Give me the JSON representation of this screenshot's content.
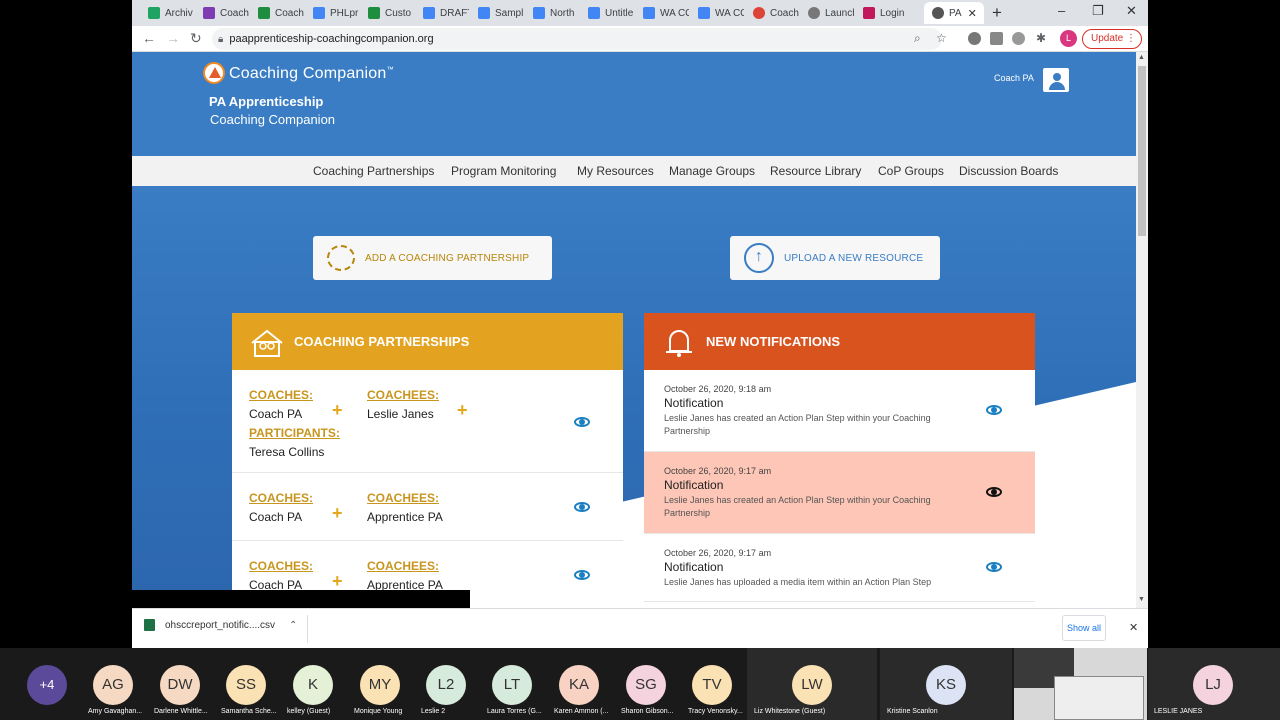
{
  "browser": {
    "tabs": [
      {
        "label": "Archiv",
        "color": "#1ea362"
      },
      {
        "label": "Coach",
        "color": "#7e3bb2"
      },
      {
        "label": "Coach",
        "color": "#1e8e3e"
      },
      {
        "label": "PHLpr",
        "color": "#4285f4"
      },
      {
        "label": "Custo",
        "color": "#1e8e3e"
      },
      {
        "label": "DRAFT",
        "color": "#4285f4"
      },
      {
        "label": "Sampl",
        "color": "#4285f4"
      },
      {
        "label": "North",
        "color": "#4285f4"
      },
      {
        "label": "Untitle",
        "color": "#4285f4"
      },
      {
        "label": "WA CC",
        "color": "#4285f4"
      },
      {
        "label": "WA CC",
        "color": "#4285f4"
      },
      {
        "label": "Coach",
        "color": "#db4437"
      },
      {
        "label": "Launch",
        "color": "#777777"
      },
      {
        "label": "Login",
        "color": "#c2185b"
      },
      {
        "label": "PA",
        "color": "#555555"
      }
    ],
    "url": "paapprenticeship-coachingcompanion.org",
    "profile_initial": "L",
    "update_label": "Update"
  },
  "header": {
    "logo_text": "Coaching Companion",
    "logo_tm": "™",
    "title_line1": "PA Apprenticeship",
    "title_line2": "Coaching Companion",
    "user_name": "Coach PA"
  },
  "nav": {
    "items": [
      "Coaching Partnerships",
      "Program Monitoring",
      "My Resources",
      "Manage Groups",
      "Resource Library",
      "CoP Groups",
      "Discussion Boards"
    ]
  },
  "actions": {
    "add_partnership": "ADD A COACHING PARTNERSHIP",
    "upload_resource": "UPLOAD A NEW RESOURCE"
  },
  "partnerships": {
    "title": "COACHING PARTNERSHIPS",
    "color": "#e3a320",
    "rows": [
      {
        "coaches_label": "COACHES:",
        "coach": "Coach PA",
        "coachees_label": "COACHEES:",
        "coachee": "Leslie Janes",
        "participants_label": "PARTICIPANTS:",
        "participant": "Teresa Collins"
      },
      {
        "coaches_label": "COACHES:",
        "coach": "Coach PA",
        "coachees_label": "COACHEES:",
        "coachee": "Apprentice PA"
      },
      {
        "coaches_label": "COACHES:",
        "coach": "Coach PA",
        "coachees_label": "COACHEES:",
        "coachee": "Apprentice PA"
      }
    ]
  },
  "notifications": {
    "title": "NEW NOTIFICATIONS",
    "color": "#d9531e",
    "items": [
      {
        "date": "October 26, 2020, 9:18 am",
        "title": "Notification",
        "desc": "Leslie Janes has created an Action Plan Step within your Coaching Partnership"
      },
      {
        "date": "October 26, 2020, 9:17 am",
        "title": "Notification",
        "desc": "Leslie Janes has created an Action Plan Step within your Coaching Partnership"
      },
      {
        "date": "October 26, 2020, 9:17 am",
        "title": "Notification",
        "desc": "Leslie Janes has uploaded a media item within an Action Plan Step"
      }
    ]
  },
  "downloads": {
    "file": "ohsccreport_notific....csv",
    "show_all": "Show all"
  },
  "meeting": {
    "overflow": "+4",
    "participants": [
      {
        "initials": "AG",
        "name": "Amy Gavaghan...",
        "color": "#f6d9c2"
      },
      {
        "initials": "DW",
        "name": "Darlene Whittle...",
        "color": "#f6d9c2"
      },
      {
        "initials": "SS",
        "name": "Samantha Sche...",
        "color": "#fbe2b5"
      },
      {
        "initials": "K",
        "name": "kelley (Guest)",
        "color": "#e4f1d6"
      },
      {
        "initials": "MY",
        "name": "Monique Young",
        "color": "#fbe2b5"
      },
      {
        "initials": "L2",
        "name": "Leslie 2",
        "color": "#d6ebdc"
      },
      {
        "initials": "LT",
        "name": "Laura Torres (G...",
        "color": "#d6ebdc"
      },
      {
        "initials": "KA",
        "name": "Karen Ammon (...",
        "color": "#f8d3c4"
      },
      {
        "initials": "SG",
        "name": "Sharon Gibson...",
        "color": "#f5d3de"
      },
      {
        "initials": "TV",
        "name": "Tracy Venonsky...",
        "color": "#fbe2b5"
      },
      {
        "initials": "LW",
        "name": "Liz Whitestone (Guest)",
        "color": "#fbe2b5"
      },
      {
        "initials": "KS",
        "name": "Kristine Scanlon",
        "color": "#dbe3f5"
      },
      {
        "initials": "LJ",
        "name": "LESLIE JANES",
        "color": "#f5d3de"
      }
    ]
  }
}
